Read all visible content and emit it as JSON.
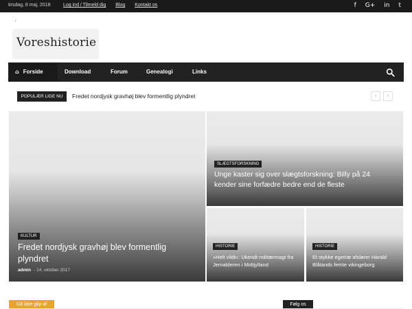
{
  "topbar": {
    "date": "tirsdag, 8 maj, 2018",
    "links": [
      "Log ind / Tilmeld dig",
      "Blog",
      "Kontakt os"
    ],
    "social": [
      {
        "icon": "facebook-icon",
        "glyph": "f"
      },
      {
        "icon": "google-plus-icon",
        "glyph": "G+"
      },
      {
        "icon": "linkedin-icon",
        "glyph": "in"
      },
      {
        "icon": "twitter-icon",
        "glyph": "t"
      }
    ]
  },
  "logo": {
    "mark": "/",
    "text": "Voreshistorie"
  },
  "nav": {
    "items": [
      "Forside",
      "Download",
      "Forum",
      "Genealogi",
      "Links"
    ],
    "home_icon": "home-icon",
    "search_icon": "search-icon"
  },
  "ticker": {
    "label": "POPULÆR LIGE NU",
    "headline": "Fredet nordjysk gravhøj blev formentlig plyndret",
    "prev": "‹",
    "next": "›"
  },
  "cards": [
    {
      "category": "KULTUR",
      "title": "Fredet nordjysk gravhøj blev formentlig plyndret",
      "author": "admin",
      "sep": "-",
      "date": "14. oktober 2017"
    },
    {
      "category": "SLÆGTSFORSKNING",
      "title": "Unge kaster sig over slægtsforskning: Billy på 24 kender sine forfædre bedre end de fleste"
    },
    {
      "category": "HISTORIE",
      "title": "»Helt vildt«: Ukendt militærmagt fra Jernalderen i Midtjylland"
    },
    {
      "category": "HISTORIE",
      "title": "Et stykke egetræ afslører Harald Blåtands femte vikingeborg"
    }
  ],
  "footer": {
    "left_label": "Gå ikke glip af",
    "right_label": "Følg os"
  },
  "colors": {
    "dark": "#222222",
    "accent": "#e6a431"
  }
}
